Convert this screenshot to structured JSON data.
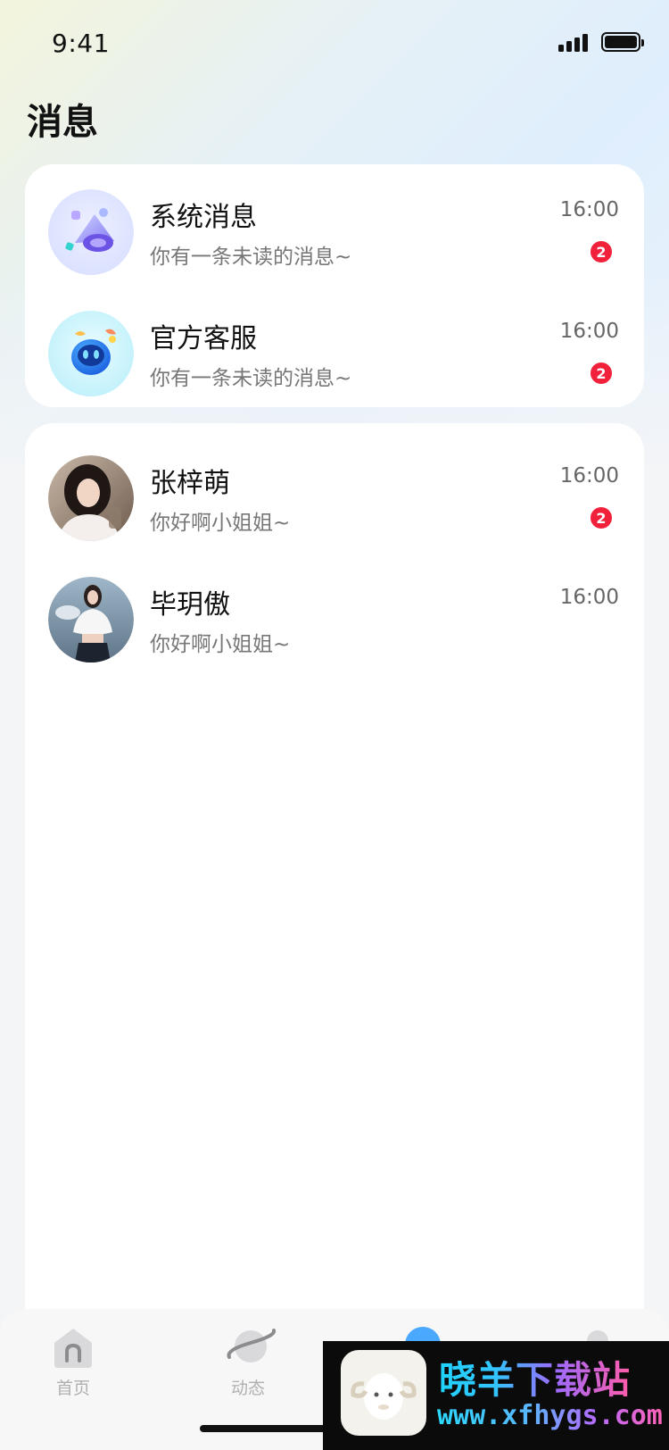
{
  "status_bar": {
    "time": "9:41"
  },
  "page": {
    "title": "消息"
  },
  "official_conversations": [
    {
      "name": "系统消息",
      "preview": "你有一条未读的消息~",
      "time": "16:00",
      "unread": "2",
      "avatar_icon": "bell-megaphone-icon"
    },
    {
      "name": "官方客服",
      "preview": "你有一条未读的消息~",
      "time": "16:00",
      "unread": "2",
      "avatar_icon": "robot-support-icon"
    }
  ],
  "user_conversations": [
    {
      "name": "张梓萌",
      "preview": "你好啊小姐姐~",
      "time": "16:00",
      "unread": "2"
    },
    {
      "name": "毕玥傲",
      "preview": "你好啊小姐姐~",
      "time": "16:00",
      "unread": ""
    }
  ],
  "tabbar": {
    "tabs": [
      {
        "label": "首页",
        "icon": "home-icon"
      },
      {
        "label": "动态",
        "icon": "planet-icon"
      },
      {
        "label": "",
        "icon": "message-icon"
      },
      {
        "label": "",
        "icon": "profile-icon"
      }
    ]
  },
  "watermark": {
    "title": "晓羊下载站",
    "url": "www.xfhygs.com"
  },
  "colors": {
    "badge": "#f2213b",
    "accent": "#4aa8ff"
  }
}
